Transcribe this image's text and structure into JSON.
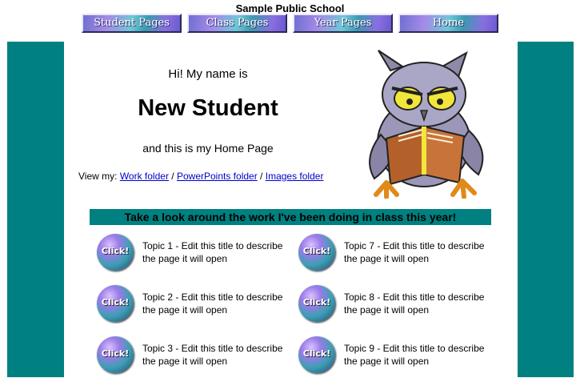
{
  "header": {
    "school_name": "Sample Public School"
  },
  "nav": [
    {
      "label": "Student Pages"
    },
    {
      "label": "Class Pages"
    },
    {
      "label": "Year Pages"
    },
    {
      "label": "Home"
    }
  ],
  "intro": {
    "greeting": "Hi! My name is",
    "name": "New Student",
    "subline": "and this is my Home Page",
    "view_prefix": "View my:",
    "links": [
      {
        "label": "Work folder"
      },
      {
        "label": "PowerPoints folder"
      },
      {
        "label": "Images folder"
      }
    ],
    "separator": "/"
  },
  "banner": "Take a look around the work I've been doing in class this year!",
  "topics": [
    {
      "button": "Click!",
      "title": "Topic 1 - Edit this title to describe the page it will open"
    },
    {
      "button": "Click!",
      "title": "Topic 2 - Edit this title to describe the page it will open"
    },
    {
      "button": "Click!",
      "title": "Topic 3 - Edit this title to describe the page it will open"
    },
    {
      "button": "Click!",
      "title": "Topic 7 - Edit this title to describe the page it will open"
    },
    {
      "button": "Click!",
      "title": "Topic 8 - Edit this title to describe the page it will open"
    },
    {
      "button": "Click!",
      "title": "Topic 9 - Edit this title to describe the page it will open"
    }
  ],
  "colors": {
    "teal": "#008080",
    "link": "#0000cc"
  }
}
